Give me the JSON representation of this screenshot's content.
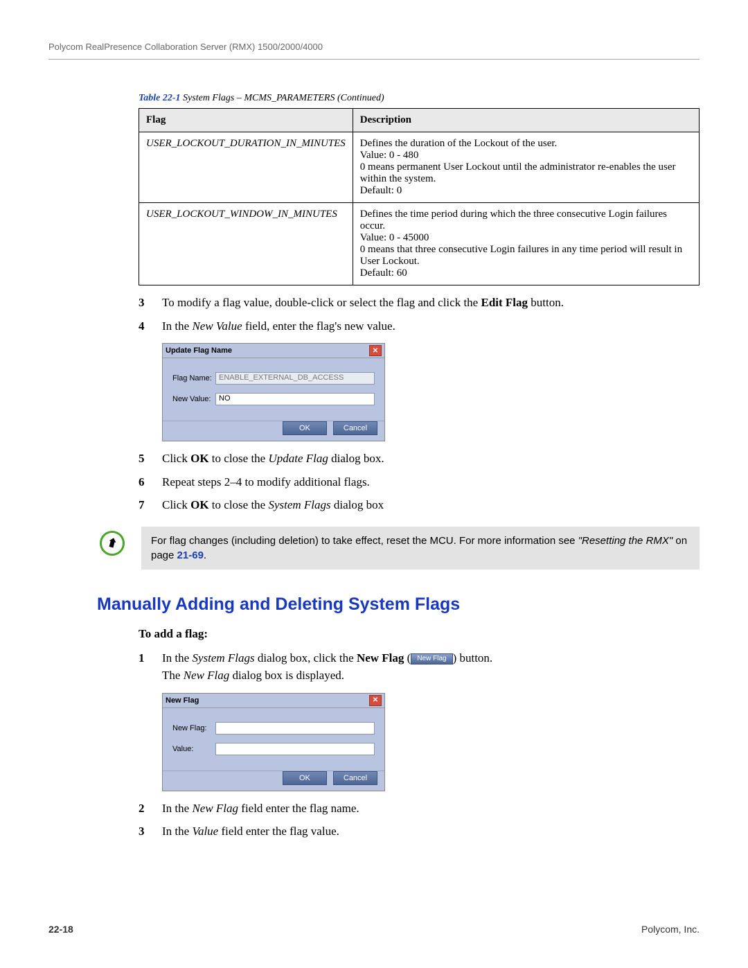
{
  "header": "Polycom RealPresence Collaboration Server (RMX) 1500/2000/4000",
  "table": {
    "caption_num": "Table 22-1",
    "caption_rest": " System Flags – MCMS_PARAMETERS (Continued)",
    "headers": {
      "flag": "Flag",
      "description": "Description"
    },
    "rows": [
      {
        "flag": "USER_LOCKOUT_DURATION_IN_MINUTES",
        "desc": "Defines the duration of the Lockout of the user.\nValue: 0 - 480\n0 means permanent User Lockout until the administrator re-enables the user within the system.\nDefault: 0"
      },
      {
        "flag": "USER_LOCKOUT_WINDOW_IN_MINUTES",
        "desc": "Defines the time period during which the three consecutive Login failures occur.\nValue: 0 - 45000\n0 means that three consecutive Login failures in any time period will result in User Lockout.\nDefault: 60"
      }
    ]
  },
  "steps_a": {
    "s3": "To modify a flag value, double-click or select the flag and click the ",
    "s3_bold": "Edit Flag",
    "s3_end": " button.",
    "s4": "In the ",
    "s4_em": "New Value",
    "s4_end": " field, enter the flag's new value.",
    "s5_a": "Click ",
    "s5_b": "OK",
    "s5_c": " to close the ",
    "s5_d": "Update Flag",
    "s5_e": " dialog box.",
    "s6": "Repeat steps 2–4 to modify additional flags.",
    "s7_a": "Click ",
    "s7_b": "OK",
    "s7_c": " to close the ",
    "s7_d": "System Flags",
    "s7_e": " dialog box"
  },
  "dialog1": {
    "title": "Update Flag Name",
    "label_flag": "Flag Name:",
    "label_val": "New Value:",
    "flag_value": "ENABLE_EXTERNAL_DB_ACCESS",
    "new_value": "NO",
    "ok": "OK",
    "cancel": "Cancel"
  },
  "note": {
    "line1": "For flag changes (including deletion) to take effect, reset the MCU. For more information see ",
    "em": "\"Resetting the RMX\"",
    "line2": " on page ",
    "link": "21-69",
    "end": "."
  },
  "heading2": "Manually Adding and Deleting System Flags",
  "subheading": "To add a flag:",
  "steps_b": {
    "s1_a": "In the ",
    "s1_b": "System Flags",
    "s1_c": " dialog box, click the ",
    "s1_d": "New Flag",
    "s1_e": " (",
    "s1_btn": "New Flag",
    "s1_f": ") button.",
    "s1_line2_a": "The ",
    "s1_line2_b": "New Flag",
    "s1_line2_c": " dialog box is displayed.",
    "s2_a": "In the ",
    "s2_b": "New Flag",
    "s2_c": " field enter the flag name.",
    "s3_a": "In the ",
    "s3_b": "Value",
    "s3_c": " field enter the flag value."
  },
  "dialog2": {
    "title": "New Flag",
    "label_flag": "New Flag:",
    "label_val": "Value:",
    "ok": "OK",
    "cancel": "Cancel"
  },
  "footer": {
    "page": "22-18",
    "company": "Polycom, Inc."
  },
  "nums": {
    "n3": "3",
    "n4": "4",
    "n5": "5",
    "n6": "6",
    "n7": "7",
    "n1": "1",
    "n2": "2",
    "n3b": "3"
  }
}
